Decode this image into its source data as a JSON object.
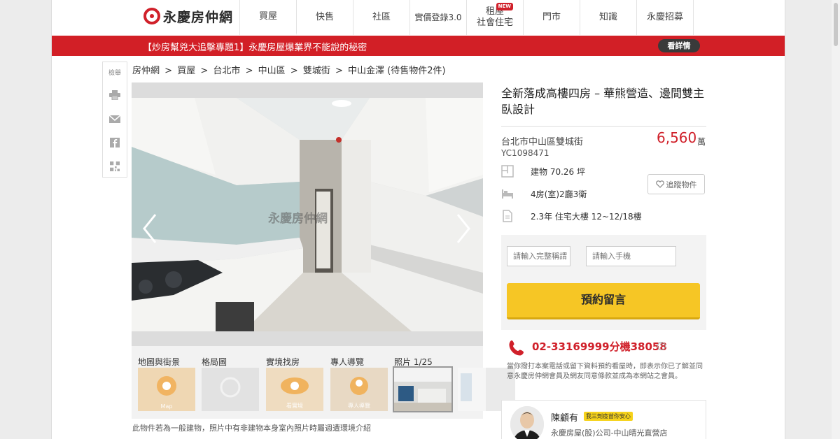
{
  "logo": {
    "text": "永慶房仲網"
  },
  "nav": {
    "items": [
      {
        "label": "買屋"
      },
      {
        "label": "快售"
      },
      {
        "label": "社區"
      },
      {
        "label": "實價登錄3.0"
      },
      {
        "label": "租屋\n社會住宅",
        "line1": "租屋",
        "line2": "社會住宅",
        "badge": "NEW"
      },
      {
        "label": "門市"
      },
      {
        "label": "知識"
      },
      {
        "label": "永慶招募"
      }
    ]
  },
  "banner": {
    "text": "【炒房幫兇大追擊專題1】永慶房屋爆業界不能說的秘密",
    "button": "看詳情"
  },
  "share": {
    "label": "檢舉",
    "icons": [
      "print-icon",
      "mail-icon",
      "facebook-icon",
      "qrcode-icon"
    ]
  },
  "breadcrumb": [
    "房仲網",
    ">",
    "買屋",
    ">",
    "台北市",
    ">",
    "中山區",
    ">",
    "雙城街",
    ">",
    "中山金澤 (待售物件2件)"
  ],
  "photo": {
    "watermark": "永慶房仲網"
  },
  "thumbs": [
    {
      "label": "地圖與街景",
      "caption": "Map"
    },
    {
      "label": "格局圖",
      "caption": ""
    },
    {
      "label": "實境找房",
      "caption": "看實境"
    },
    {
      "label": "專人導覽",
      "caption": "專人導覽"
    },
    {
      "label": "照片 1/25",
      "caption": ""
    },
    {
      "label": "",
      "caption": ""
    }
  ],
  "disclaimer": "此物件若為一般建物，照片中有非建物本身室內照片時屬週遭環境介紹",
  "listing": {
    "title": "全新落成高樓四房 – 華熊營造、邊間雙主臥設計",
    "address": "台北市中山區雙城街",
    "code": "YC1098471",
    "price": "6,560",
    "price_unit": "萬",
    "specs": [
      {
        "icon": "floorplan-icon",
        "text": "建物 70.26 坪"
      },
      {
        "icon": "bed-icon",
        "text": "4房(室)2廳3衛"
      },
      {
        "icon": "document-icon",
        "text": "2.3年 住宅大樓 12~12/18樓"
      }
    ],
    "follow_label": "追蹤物件"
  },
  "form": {
    "name_placeholder": "請輸入完整稱謂",
    "phone_placeholder": "請輸入手機",
    "submit_label": "預約留言"
  },
  "contact": {
    "phone": "02-33169999分機38058",
    "help": "?",
    "notice": "當你撥打本案電話或留下資料預約看屋時，即表示你已了解並同意永慶房仲網會員及網友同意條款並成為本網站之會員。"
  },
  "agent": {
    "name": "陳顧有",
    "tag": "我三劑疫苗你安心",
    "company": "永慶房屋(股)公司-中山晴光直營店"
  },
  "colors": {
    "brand_red": "#d21f26",
    "button_yellow": "#f6c625",
    "price_red": "#d0202a"
  }
}
